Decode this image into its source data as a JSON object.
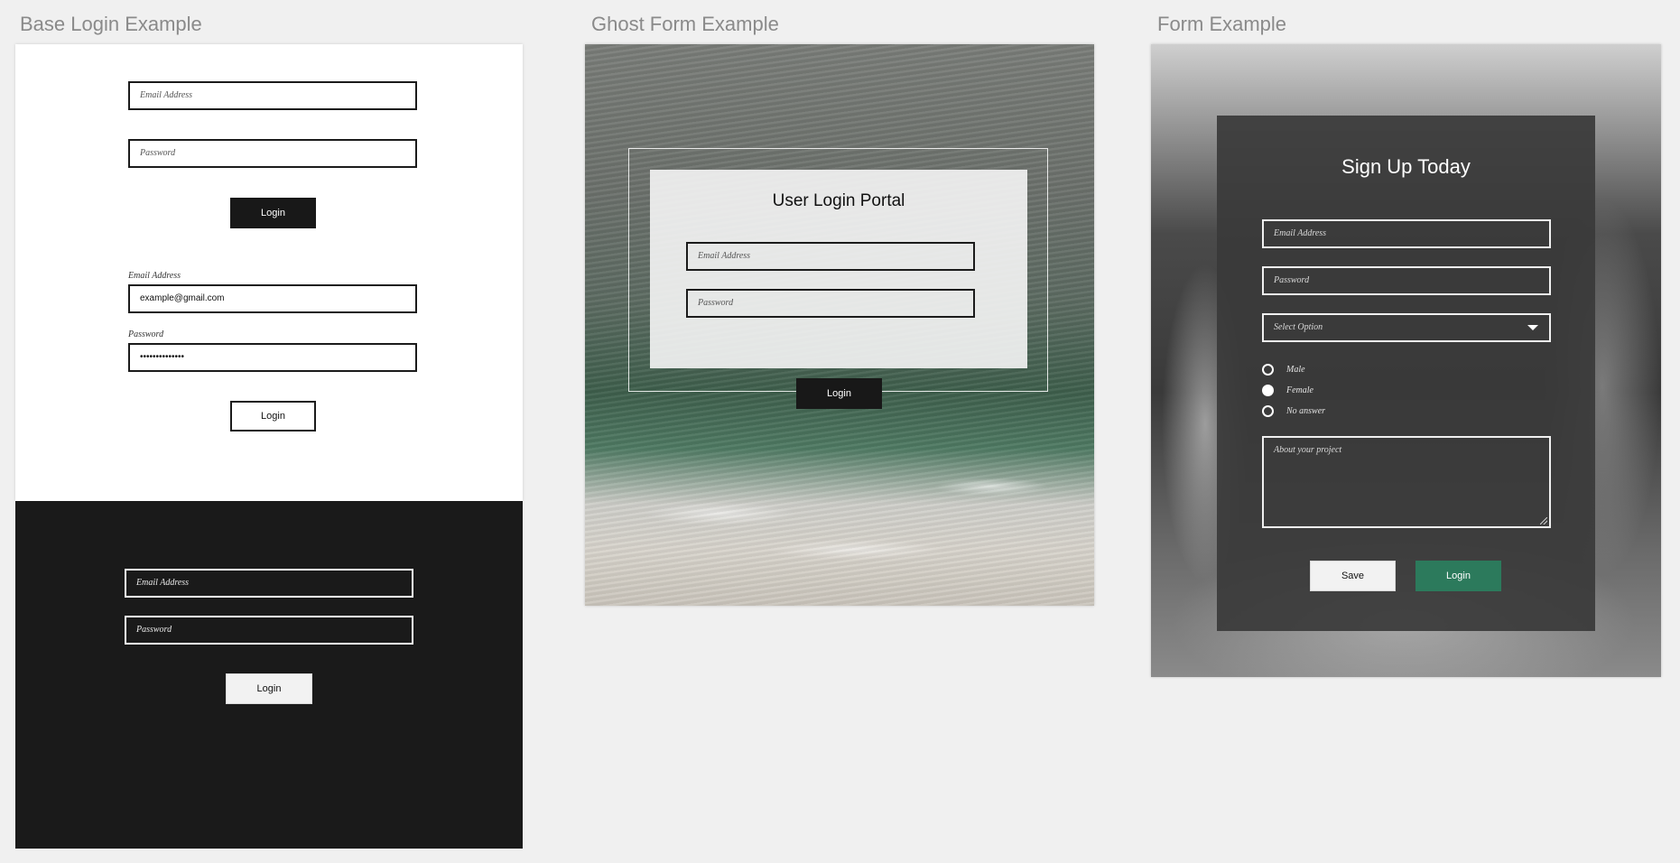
{
  "sections": {
    "base": {
      "title": "Base Login Example"
    },
    "ghost": {
      "title": "Ghost Form Example"
    },
    "form": {
      "title": "Form Example"
    }
  },
  "base_form_1": {
    "email_placeholder": "Email Address",
    "password_placeholder": "Password",
    "login_label": "Login"
  },
  "base_form_2": {
    "email_label": "Email Address",
    "email_value": "example@gmail.com",
    "password_label": "Password",
    "password_value": "••••••••••••••",
    "login_label": "Login"
  },
  "base_form_dark": {
    "email_placeholder": "Email Address",
    "password_placeholder": "Password",
    "login_label": "Login"
  },
  "ghost_form": {
    "title": "User Login Portal",
    "email_placeholder": "Email Address",
    "password_placeholder": "Password",
    "login_label": "Login"
  },
  "signup_form": {
    "title": "Sign Up Today",
    "email_placeholder": "Email Address",
    "password_placeholder": "Password",
    "select_value": "Select Option",
    "radios": [
      {
        "label": "Male",
        "selected": false
      },
      {
        "label": "Female",
        "selected": true
      },
      {
        "label": "No answer",
        "selected": false
      }
    ],
    "textarea_placeholder": "About your project",
    "save_label": "Save",
    "login_label": "Login"
  },
  "colors": {
    "accent_green": "#2c7a5c",
    "dark_panel": "#1a1a1a",
    "page_bg": "#f0f0f0"
  },
  "icons": [
    "chevron-down-icon",
    "resize-grip-icon"
  ]
}
